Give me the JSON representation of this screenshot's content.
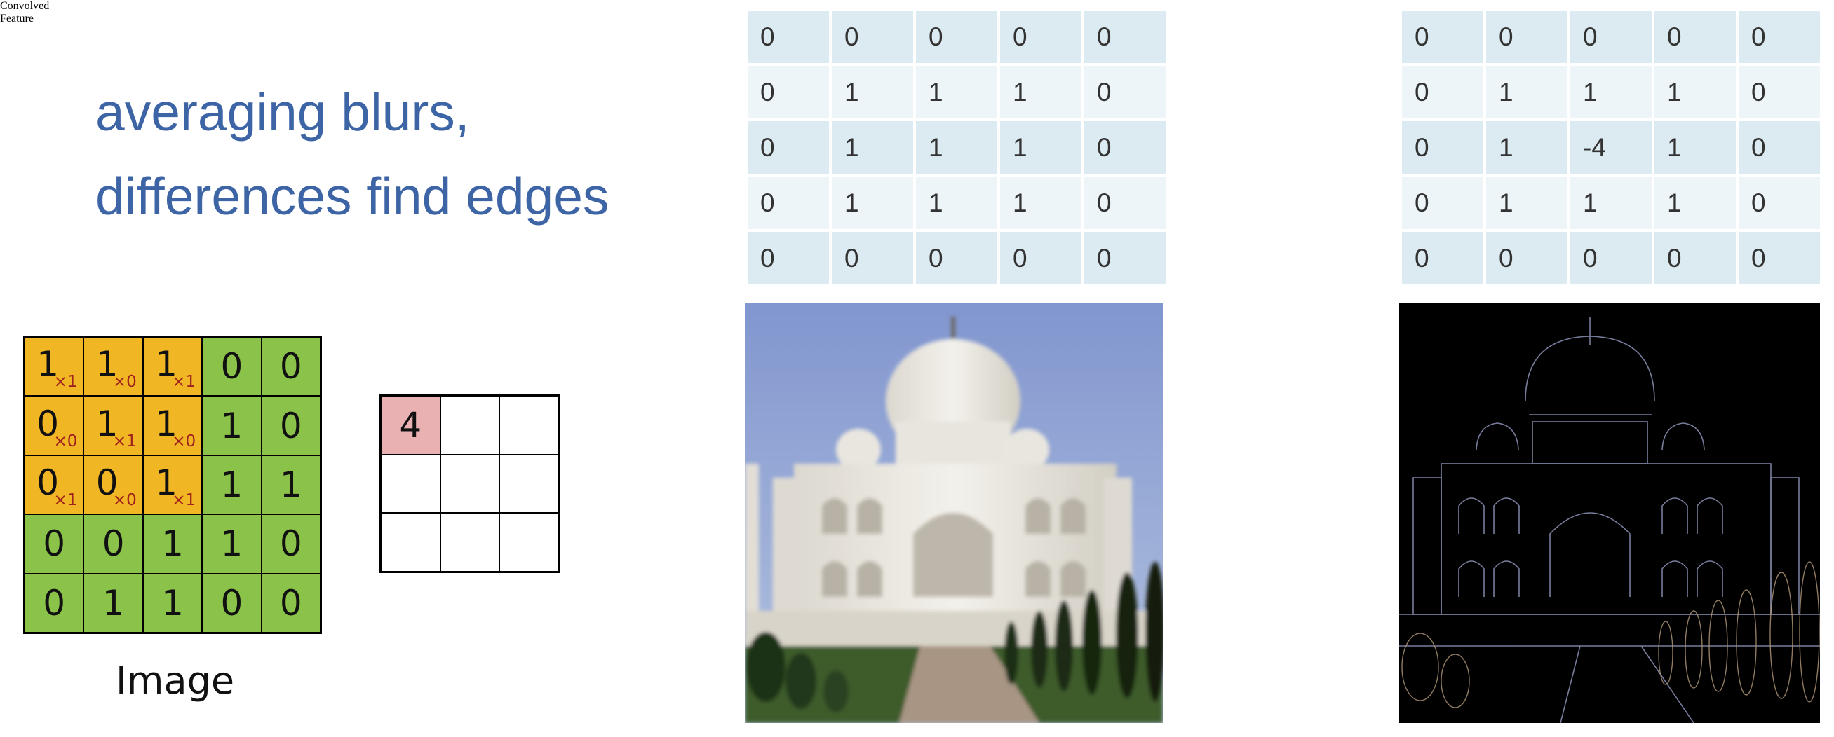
{
  "headline": {
    "line1": "averaging blurs,",
    "line2": "differences find edges"
  },
  "kernel_average": [
    [
      "0",
      "0",
      "0",
      "0",
      "0"
    ],
    [
      "0",
      "1",
      "1",
      "1",
      "0"
    ],
    [
      "0",
      "1",
      "1",
      "1",
      "0"
    ],
    [
      "0",
      "1",
      "1",
      "1",
      "0"
    ],
    [
      "0",
      "0",
      "0",
      "0",
      "0"
    ]
  ],
  "kernel_edges": [
    [
      "0",
      "0",
      "0",
      "0",
      "0"
    ],
    [
      "0",
      "1",
      "1",
      "1",
      "0"
    ],
    [
      "0",
      "1",
      "-4",
      "1",
      "0"
    ],
    [
      "0",
      "1",
      "1",
      "1",
      "0"
    ],
    [
      "0",
      "0",
      "0",
      "0",
      "0"
    ]
  ],
  "image_grid": [
    [
      {
        "v": "1",
        "w": "×1"
      },
      {
        "v": "1",
        "w": "×0"
      },
      {
        "v": "1",
        "w": "×1"
      },
      {
        "v": "0"
      },
      {
        "v": "0"
      }
    ],
    [
      {
        "v": "0",
        "w": "×0"
      },
      {
        "v": "1",
        "w": "×1"
      },
      {
        "v": "1",
        "w": "×0"
      },
      {
        "v": "1"
      },
      {
        "v": "0"
      }
    ],
    [
      {
        "v": "0",
        "w": "×1"
      },
      {
        "v": "0",
        "w": "×0"
      },
      {
        "v": "1",
        "w": "×1"
      },
      {
        "v": "1"
      },
      {
        "v": "1"
      }
    ],
    [
      {
        "v": "0"
      },
      {
        "v": "0"
      },
      {
        "v": "1"
      },
      {
        "v": "1"
      },
      {
        "v": "0"
      }
    ],
    [
      {
        "v": "0"
      },
      {
        "v": "1"
      },
      {
        "v": "1"
      },
      {
        "v": "0"
      },
      {
        "v": "0"
      }
    ]
  ],
  "image_caption": "Image",
  "convolved": [
    "4",
    "",
    "",
    "",
    "",
    "",
    "",
    "",
    ""
  ],
  "convolved_caption": {
    "line1": "Convolved",
    "line2": "Feature"
  },
  "colors": {
    "title": "#3d65a6",
    "window_cell": "#f1b623",
    "image_cell": "#8bc34a",
    "weight_text": "#a0221e",
    "result_cell": "#eab1b3"
  }
}
